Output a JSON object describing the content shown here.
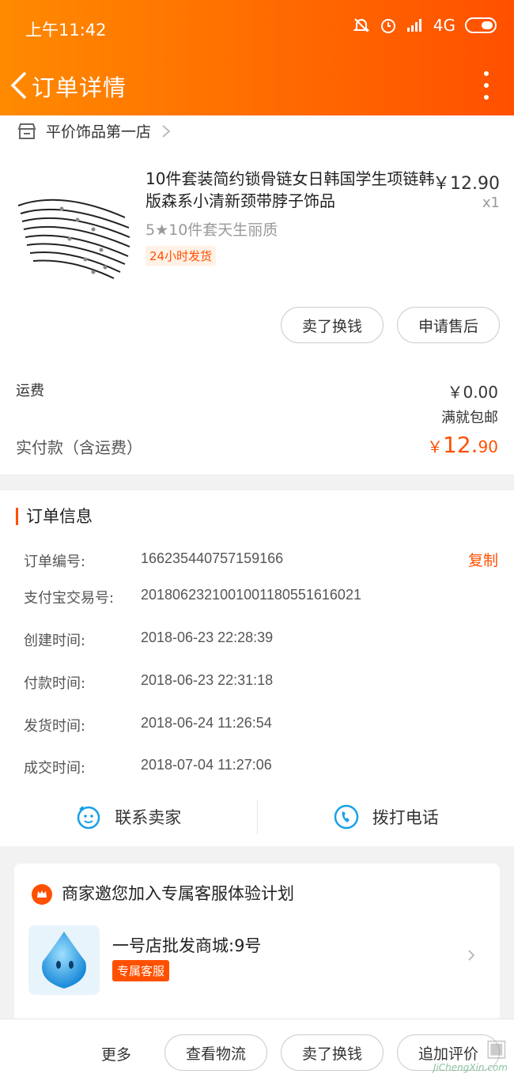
{
  "status_bar": {
    "time": "上午11:42",
    "network": "4G"
  },
  "header": {
    "title": "订单详情"
  },
  "shop": {
    "name": "平价饰品第一店"
  },
  "product": {
    "title": "10件套装简约锁骨链女日韩国学生项链韩版森系小清新颈带脖子饰品",
    "price": "￥12.90",
    "quantity": "x1",
    "spec": "5★10件套天生丽质",
    "tag": "24小时发货"
  },
  "item_actions": {
    "resell": "卖了换钱",
    "after_sale": "申请售后"
  },
  "payment": {
    "shipping_label": "运费",
    "shipping_value": "￥0.00",
    "shipping_note": "满就包邮",
    "total_label": "实付款（含运费）",
    "total_currency": "￥",
    "total_int": "12.",
    "total_dec": "90"
  },
  "order_info": {
    "title": "订单信息",
    "copy_label": "复制",
    "rows": [
      {
        "label": "订单编号:",
        "value": "166235440757159166"
      },
      {
        "label": "支付宝交易号:",
        "value": "2018062321001001180551616021"
      },
      {
        "label": "创建时间:",
        "value": "2018-06-23 22:28:39"
      },
      {
        "label": "付款时间:",
        "value": "2018-06-23 22:31:18"
      },
      {
        "label": "发货时间:",
        "value": "2018-06-24 11:26:54"
      },
      {
        "label": "成交时间:",
        "value": "2018-07-04 11:27:06"
      }
    ]
  },
  "contact": {
    "seller": "联系卖家",
    "call": "拨打电话"
  },
  "service": {
    "title": "商家邀您加入专属客服体验计划",
    "name": "一号店批发商城:9号",
    "badge": "专属客服"
  },
  "bottom_bar": {
    "more": "更多",
    "logistics": "查看物流",
    "resell": "卖了换钱",
    "review": "追加评价"
  },
  "watermark": {
    "text": "JiChengXin.com"
  },
  "colors": {
    "accent": "#ff5000",
    "header_start": "#ff8a00",
    "header_end": "#ff5000",
    "text_gray": "#999999"
  }
}
